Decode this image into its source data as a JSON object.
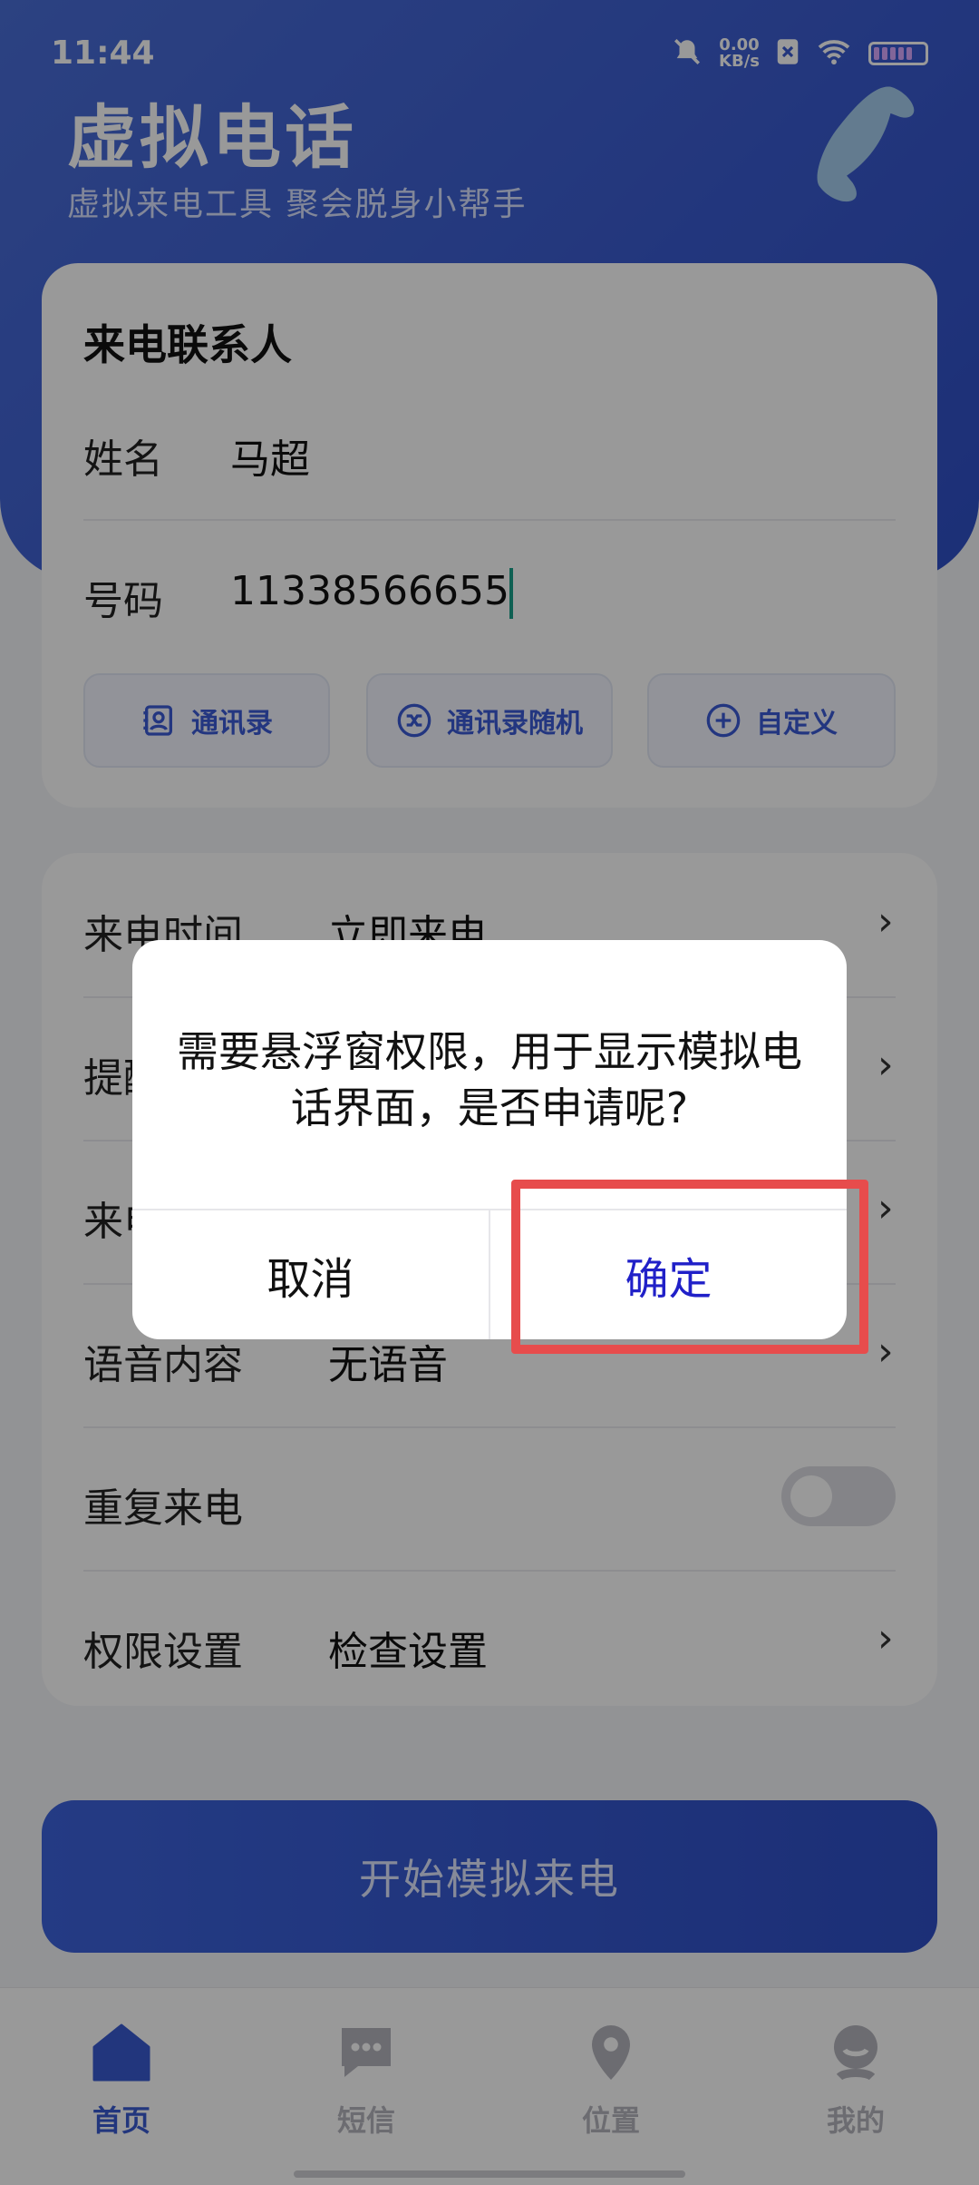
{
  "status_bar": {
    "time": "11:44",
    "net_speed_value": "0.00",
    "net_speed_unit": "KB/s"
  },
  "header": {
    "title": "虚拟电话",
    "subtitle": "虚拟来电工具 聚会脱身小帮手"
  },
  "contact_card": {
    "title": "来电联系人",
    "name_label": "姓名",
    "name_value": "马超",
    "number_label": "号码",
    "number_value": "11338566655",
    "buttons": [
      {
        "label": "通讯录",
        "icon": "contact-book-icon"
      },
      {
        "label": "通讯录随机",
        "icon": "shuffle-icon"
      },
      {
        "label": "自定义",
        "icon": "plus-circle-icon"
      }
    ]
  },
  "settings": {
    "rows": [
      {
        "label": "来电时间",
        "value": "立即来电"
      },
      {
        "label": "提醒",
        "value": ""
      },
      {
        "label": "来电",
        "value": ""
      },
      {
        "label": "语音内容",
        "value": "无语音"
      },
      {
        "label": "重复来电",
        "value": ""
      },
      {
        "label": "权限设置",
        "value": "检查设置"
      }
    ],
    "repeat_enabled": false
  },
  "start_button": "开始模拟来电",
  "bottom_nav": [
    {
      "label": "首页",
      "icon": "home-icon",
      "active": true
    },
    {
      "label": "短信",
      "icon": "message-icon",
      "active": false
    },
    {
      "label": "位置",
      "icon": "location-pin-icon",
      "active": false
    },
    {
      "label": "我的",
      "icon": "profile-icon",
      "active": false
    }
  ],
  "dialog": {
    "message": "需要悬浮窗权限，用于显示模拟电话界面，是否申请呢?",
    "cancel": "取消",
    "confirm": "确定"
  },
  "colors": {
    "brand": "#3a5bd0",
    "dialog_confirm": "#2020c8",
    "highlight": "#e74c4c"
  }
}
